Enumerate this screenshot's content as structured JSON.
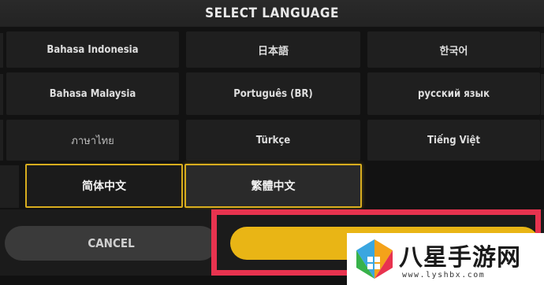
{
  "dialog": {
    "title": "SELECT LANGUAGE"
  },
  "languages": [
    {
      "label": "Bahasa Indonesia"
    },
    {
      "label": "日本語"
    },
    {
      "label": "한국어"
    },
    {
      "label": "Bahasa Malaysia"
    },
    {
      "label": "Português (BR)"
    },
    {
      "label": "русский язык"
    },
    {
      "label": "ภาษาไทย"
    },
    {
      "label": "Türkçe"
    },
    {
      "label": "Tiếng Việt"
    },
    {
      "label": "简体中文"
    },
    {
      "label": "繁體中文"
    }
  ],
  "buttons": {
    "cancel": "CANCEL",
    "confirm": ""
  },
  "watermark": {
    "brand": "八星手游网",
    "url": "www.lyshbx.com"
  },
  "colors": {
    "accent": "#e9b515",
    "selection_border": "#d8ad1e",
    "annotation_red": "#e8334f"
  }
}
